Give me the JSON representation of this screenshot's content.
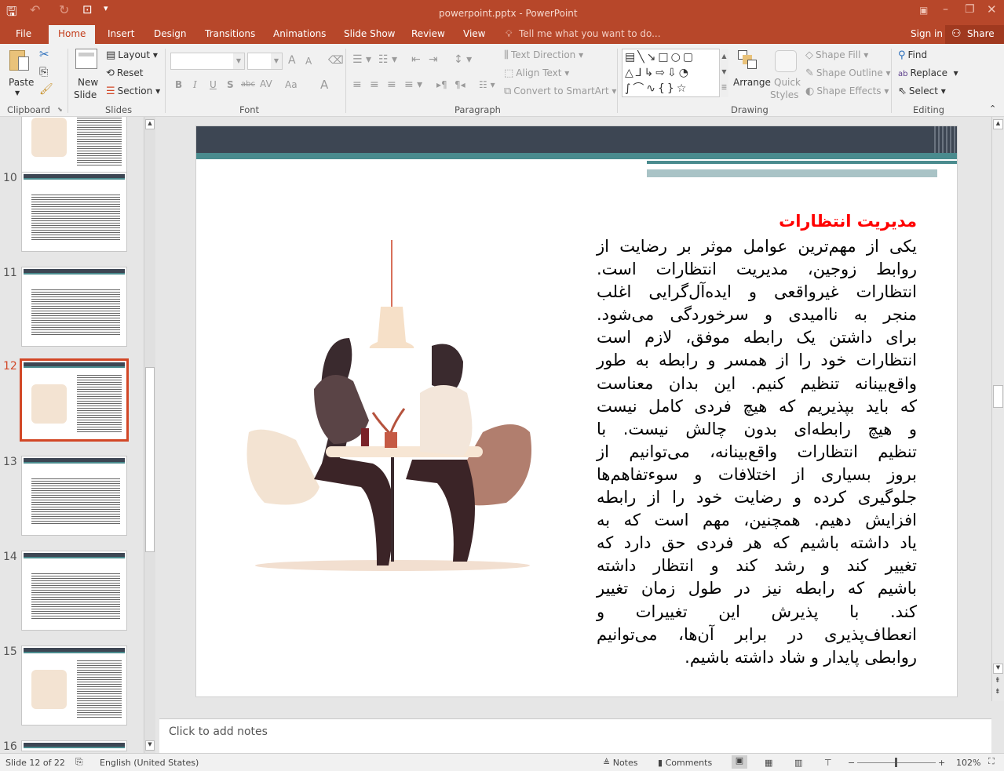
{
  "titlebar": {
    "title": "powerpoint.pptx - PowerPoint",
    "qat_icons": [
      "save-icon",
      "undo-icon",
      "redo-icon",
      "start-from-beginning-icon",
      "customize-qat-icon"
    ],
    "window_icons": [
      "ribbon-display-options-icon",
      "minimize-icon",
      "restore-icon",
      "close-icon"
    ]
  },
  "tabs": [
    {
      "label": "File"
    },
    {
      "label": "Home"
    },
    {
      "label": "Insert"
    },
    {
      "label": "Design"
    },
    {
      "label": "Transitions"
    },
    {
      "label": "Animations"
    },
    {
      "label": "Slide Show"
    },
    {
      "label": "Review"
    },
    {
      "label": "View"
    }
  ],
  "tell_me": "Tell me what you want to do...",
  "sign_in": "Sign in",
  "share": "Share",
  "ribbon": {
    "clipboard": {
      "label": "Clipboard",
      "paste": "Paste"
    },
    "slides": {
      "label": "Slides",
      "new_slide": "New",
      "new_slide2": "Slide",
      "layout": "Layout",
      "reset": "Reset",
      "section": "Section"
    },
    "font": {
      "label": "Font",
      "bold": "B",
      "italic": "I",
      "underline": "U",
      "shadow": "S",
      "strike": "abc",
      "spacing": "AV",
      "case": "Aa",
      "color": "A",
      "grow": "A",
      "shrink": "A"
    },
    "paragraph": {
      "label": "Paragraph",
      "text_direction": "Text Direction",
      "align_text": "Align Text",
      "smartart": "Convert to SmartArt"
    },
    "drawing": {
      "label": "Drawing",
      "arrange": "Arrange",
      "quick_styles": "Quick",
      "quick_styles2": "Styles",
      "shape_fill": "Shape Fill",
      "shape_outline": "Shape Outline",
      "shape_effects": "Shape Effects"
    },
    "editing": {
      "label": "Editing",
      "find": "Find",
      "replace": "Replace",
      "select": "Select"
    }
  },
  "thumbnails": [
    {
      "number": ""
    },
    {
      "number": "10"
    },
    {
      "number": "11"
    },
    {
      "number": "12"
    },
    {
      "number": "13"
    },
    {
      "number": "14"
    },
    {
      "number": "15"
    },
    {
      "number": "16"
    }
  ],
  "selected_slide": "12",
  "slide": {
    "title": "مدیریت انتظارات",
    "lines": [
      "یکی از مهم‌ترین عوامل موثر بر رضایت از",
      "روابط زوجین، مدیریت انتظارات است.",
      "انتظارات غیرواقعی و ایده‌آل‌گرایی اغلب",
      "منجر به ناامیدی و سرخوردگی می‌شود.",
      "برای داشتن یک رابطه موفق، لازم است",
      "انتظارات خود را از همسر و رابطه به طور",
      "واقع‌بینانه تنظیم کنیم. این بدان معناست",
      "که باید بپذیریم که هیچ فردی کامل نیست",
      "و هیچ رابطه‌ای بدون چالش نیست. با",
      "تنظیم انتظارات واقع‌بینانه، می‌توانیم از",
      "بروز بسیاری از اختلافات و سوءتفاهم‌ها",
      "جلوگیری کرده و رضایت خود را از رابطه",
      "افزایش دهیم. همچنین، مهم است که به",
      "یاد داشته باشیم که هر فردی حق دارد که",
      "تغییر کند و رشد کند و انتظار داشته",
      "باشیم که رابطه نیز در طول زمان تغییر",
      "کند. با پذیرش این تغییرات و",
      "انعطاف‌پذیری در برابر آن‌ها، می‌توانیم",
      "روابطی پایدار و شاد داشته باشیم."
    ],
    "colors": {
      "header_band": "#3d4653",
      "teal": "#4a8b8e",
      "title": "#ff0000"
    }
  },
  "notes_placeholder": "Click to add notes",
  "status": {
    "slide": "Slide 12 of 22",
    "language": "English (United States)",
    "notes": "Notes",
    "comments": "Comments",
    "zoom": "102%",
    "zoom_level_percent": 102
  },
  "accent": "#b7472a"
}
